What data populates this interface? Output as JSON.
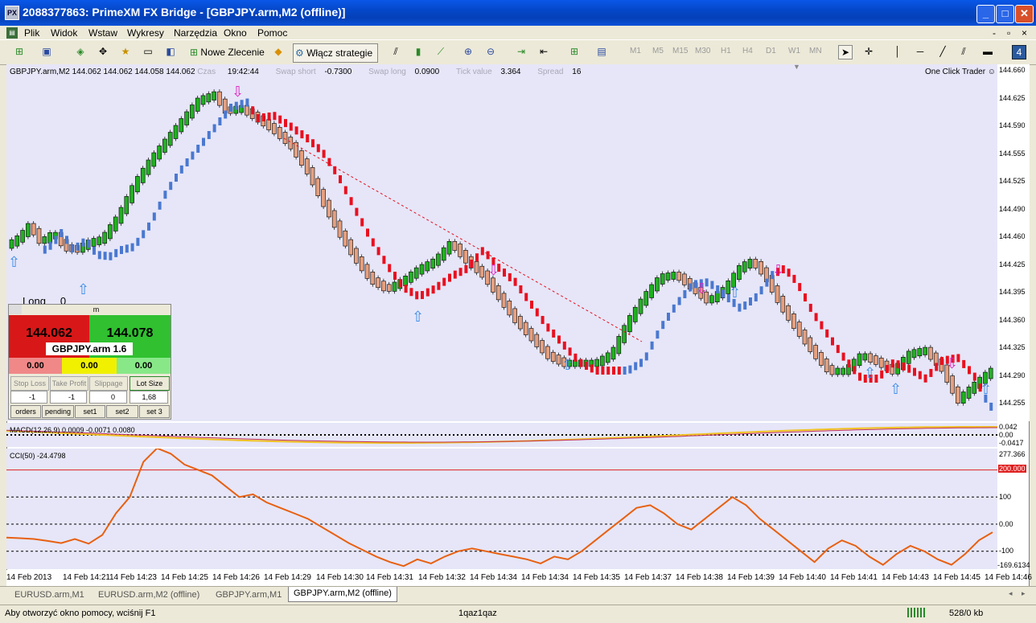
{
  "window": {
    "title": "2088377863: PrimeXM FX Bridge - [GBPJPY.arm,M2 (offline)]",
    "app_icon": "PX",
    "minimize": "_",
    "maximize": "□",
    "close": "✕",
    "mdi_controls": [
      "-",
      "▫",
      "×"
    ]
  },
  "menu": [
    "Plik",
    "Widok",
    "Wstaw",
    "Wykresy",
    "Narzędzia",
    "Okno",
    "Pomoc"
  ],
  "toolbar": {
    "new_order": "Nowe Zlecenie",
    "strategies": "Włącz strategie",
    "timeframes": [
      "M1",
      "M5",
      "M15",
      "M30",
      "H1",
      "H4",
      "D1",
      "W1",
      "MN"
    ],
    "period_badge": "4"
  },
  "chart": {
    "symbol_info": "GBPJPY.arm,M2  144.062 144.062 144.058 144.062",
    "time_label": "Czas",
    "time_value": "19:42:44",
    "swap_short_label": "Swap short",
    "swap_short_value": "-0.7300",
    "swap_long_label": "Swap long",
    "swap_long_value": "0.0900",
    "tick_value_label": "Tick value",
    "tick_value_value": "3.364",
    "spread_label": "Spread",
    "spread_value": "16",
    "one_click": "One Click Trader ☺",
    "long_label": "Long",
    "long_value": "0",
    "price_ticks": [
      "144.660",
      "144.625",
      "144.590",
      "144.555",
      "144.525",
      "144.490",
      "144.460",
      "144.425",
      "144.395",
      "144.360",
      "144.325",
      "144.290",
      "144.255"
    ],
    "colors": {
      "bull": "#22b022",
      "bear": "#e5a080",
      "ma_up": "#4a78d0",
      "ma_down": "#e81020",
      "background": "#e6e6f8"
    }
  },
  "macd": {
    "label": "MACD(12,26,9) 0.0009 -0.0071 0.0080",
    "scale": [
      "0.042",
      "0.00",
      "-0.0417"
    ]
  },
  "cci": {
    "label": "CCI(50) -24.4798",
    "scale": [
      "277.366",
      "200.000",
      "100",
      "0.00",
      "-100",
      "-169.6134"
    ],
    "values": [
      -50,
      -52,
      -55,
      -62,
      -70,
      -55,
      -72,
      -40,
      40,
      100,
      230,
      280,
      260,
      220,
      200,
      180,
      140,
      100,
      110,
      80,
      60,
      40,
      20,
      -10,
      -40,
      -70,
      -95,
      -120,
      -140,
      -155,
      -130,
      -145,
      -120,
      -100,
      -90,
      -100,
      -110,
      -120,
      -130,
      -145,
      -120,
      -130,
      -100,
      -60,
      -20,
      20,
      60,
      70,
      40,
      0,
      -20,
      20,
      60,
      100,
      70,
      20,
      -20,
      -60,
      -100,
      -140,
      -90,
      -60,
      -80,
      -120,
      -150,
      -110,
      -80,
      -100,
      -130,
      -150,
      -110,
      -60,
      -30
    ]
  },
  "time_axis": [
    "14 Feb 2013",
    "14 Feb 14:21",
    "14 Feb 14:23",
    "14 Feb 14:25",
    "14 Feb 14:26",
    "14 Feb 14:29",
    "14 Feb 14:30",
    "14 Feb 14:31",
    "14 Feb 14:32",
    "14 Feb 14:34",
    "14 Feb 14:34",
    "14 Feb 14:35",
    "14 Feb 14:37",
    "14 Feb 14:38",
    "14 Feb 14:39",
    "14 Feb 14:40",
    "14 Feb 14:41",
    "14 Feb 14:43",
    "14 Feb 14:45",
    "14 Feb 14:46"
  ],
  "trade_panel": {
    "handle": "m",
    "bid": "144.062",
    "ask": "144.078",
    "symbol": "GBPJPY.arm 1.6",
    "values": [
      "0.00",
      "0.00",
      "0.00"
    ],
    "labels": [
      "Stop Loss",
      "Take Profit",
      "Slippage",
      "Lot Size"
    ],
    "inputs": [
      "-1",
      "-1",
      "0",
      "1,68"
    ],
    "buttons": [
      "orders",
      "pending",
      "set1",
      "set2",
      "set 3"
    ]
  },
  "tabs": [
    {
      "label": "EURUSD.arm,M1",
      "active": false
    },
    {
      "label": "EURUSD.arm,M2 (offline)",
      "active": false
    },
    {
      "label": "GBPJPY.arm,M1",
      "active": false
    },
    {
      "label": "GBPJPY.arm,M2 (offline)",
      "active": true
    }
  ],
  "status": {
    "help": "Aby otworzyć okno pomocy, wciśnij F1",
    "profile": "1qaz1qaz",
    "traffic": "528/0 kb"
  }
}
